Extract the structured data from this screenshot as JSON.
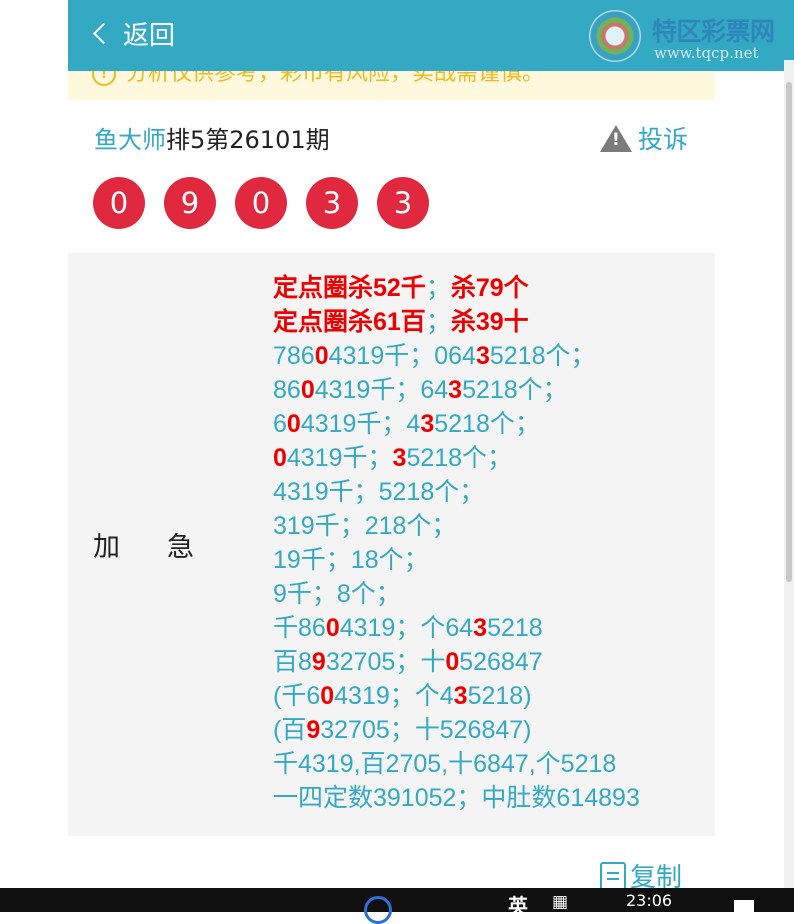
{
  "nav": {
    "back_label": "返回"
  },
  "watermark": {
    "brand": "特区彩票网",
    "url": "www.tqcp.net"
  },
  "notice": {
    "text": "分析仅供参考，彩市有风险，实战需谨慎。"
  },
  "header": {
    "master": "鱼大师",
    "issue": "排5第26101期",
    "complain_label": "投诉"
  },
  "balls": [
    "0",
    "9",
    "0",
    "3",
    "3"
  ],
  "card": {
    "label_a": "加",
    "label_b": "急",
    "lines": [
      {
        "bold": true,
        "segs": [
          {
            "t": "定点圈杀52千"
          },
          {
            "t": "；",
            "sep": true
          },
          {
            "t": "杀79个"
          }
        ]
      },
      {
        "bold": true,
        "segs": [
          {
            "t": "定点圈杀61百"
          },
          {
            "t": "；",
            "sep": true
          },
          {
            "t": "杀39十"
          }
        ]
      },
      {
        "segs": [
          {
            "t": "786"
          },
          {
            "t": "0",
            "r": true
          },
          {
            "t": "4319千；064"
          },
          {
            "t": "3",
            "r": true
          },
          {
            "t": "5218个；"
          }
        ]
      },
      {
        "segs": [
          {
            "t": "86"
          },
          {
            "t": "0",
            "r": true
          },
          {
            "t": "4319千；64"
          },
          {
            "t": "3",
            "r": true
          },
          {
            "t": "5218个；"
          }
        ]
      },
      {
        "segs": [
          {
            "t": "6"
          },
          {
            "t": "0",
            "r": true
          },
          {
            "t": "4319千；4"
          },
          {
            "t": "3",
            "r": true
          },
          {
            "t": "5218个；"
          }
        ]
      },
      {
        "segs": [
          {
            "t": "0",
            "r": true
          },
          {
            "t": "4319千；"
          },
          {
            "t": "3",
            "r": true
          },
          {
            "t": "5218个；"
          }
        ]
      },
      {
        "segs": [
          {
            "t": "4319千；5218个；"
          }
        ]
      },
      {
        "segs": [
          {
            "t": "319千；218个；"
          }
        ]
      },
      {
        "segs": [
          {
            "t": "19千；18个；"
          }
        ]
      },
      {
        "segs": [
          {
            "t": "9千；8个；"
          }
        ]
      },
      {
        "segs": [
          {
            "t": "千86"
          },
          {
            "t": "0",
            "r": true
          },
          {
            "t": "4319；个64"
          },
          {
            "t": "3",
            "r": true
          },
          {
            "t": "5218"
          }
        ]
      },
      {
        "segs": [
          {
            "t": "百8"
          },
          {
            "t": "9",
            "r": true
          },
          {
            "t": "32705；十"
          },
          {
            "t": "0",
            "r": true
          },
          {
            "t": "526847"
          }
        ]
      },
      {
        "segs": [
          {
            "t": "(千6"
          },
          {
            "t": "0",
            "r": true
          },
          {
            "t": "4319；个4"
          },
          {
            "t": "3",
            "r": true
          },
          {
            "t": "5218)"
          }
        ]
      },
      {
        "segs": [
          {
            "t": "(百"
          },
          {
            "t": "9",
            "r": true
          },
          {
            "t": "32705；十526847)"
          }
        ]
      },
      {
        "segs": [
          {
            "t": "千4319,百2705,十6847,个5218"
          }
        ]
      },
      {
        "segs": [
          {
            "t": "一四定数391052；中肚数614893"
          }
        ]
      }
    ]
  },
  "footer": {
    "copy_label": "复制"
  },
  "taskbar": {
    "ime": "英",
    "clock": "23:06"
  },
  "colors": {
    "accent": "#33a9c3",
    "ball": "#e0283e",
    "highlight": "#ee0000",
    "notice": "#f3b81f"
  }
}
